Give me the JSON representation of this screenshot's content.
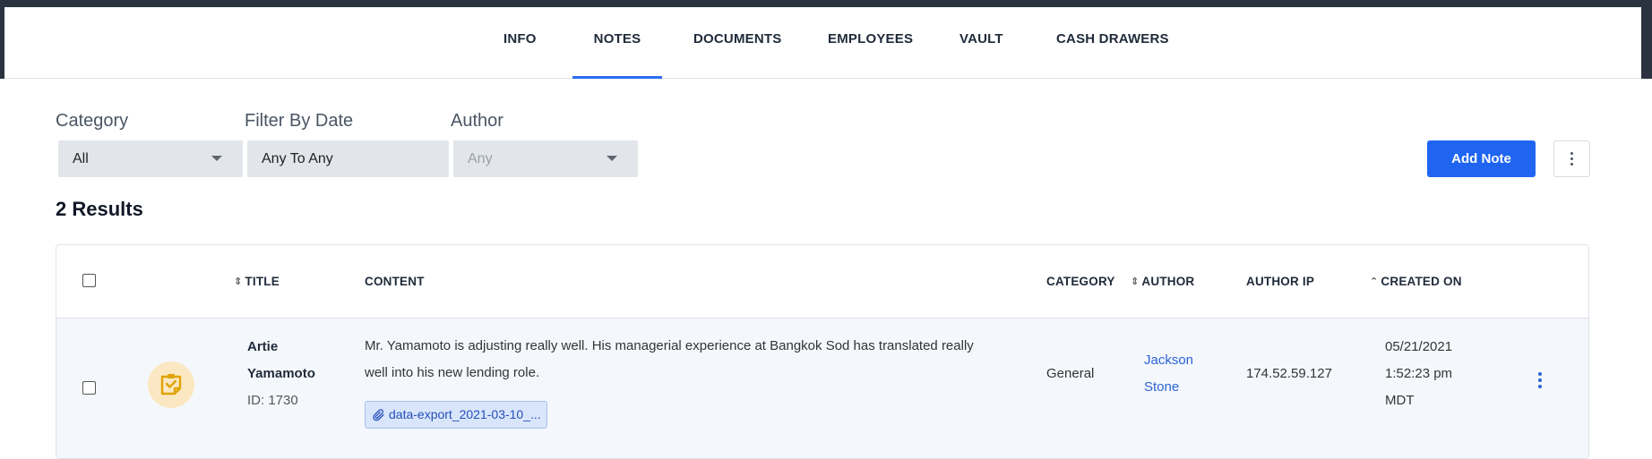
{
  "tabs": [
    {
      "label": "INFO",
      "active": false
    },
    {
      "label": "NOTES",
      "active": true
    },
    {
      "label": "DOCUMENTS",
      "active": false
    },
    {
      "label": "EMPLOYEES",
      "active": false
    },
    {
      "label": "VAULT",
      "active": false
    },
    {
      "label": "CASH DRAWERS",
      "active": false
    }
  ],
  "filters": {
    "category": {
      "label": "Category",
      "value": "All"
    },
    "date": {
      "label": "Filter By Date",
      "value": "Any To Any"
    },
    "author": {
      "label": "Author",
      "value": "Any",
      "disabled": true
    }
  },
  "actions": {
    "add_note_label": "Add Note"
  },
  "results_label": "2 Results",
  "table": {
    "columns": [
      "TITLE",
      "CONTENT",
      "CATEGORY",
      "AUTHOR",
      "AUTHOR IP",
      "CREATED ON"
    ],
    "rows": [
      {
        "title_line1": "Artie",
        "title_line2": "Yamamoto",
        "id": "ID: 1730",
        "content_line1": "Mr. Yamamoto is adjusting really well. His managerial experience at Bangkok Sod has translated really",
        "content_line2": "well into his new lending role.",
        "attachment": "data-export_2021-03-10_...",
        "category": "General",
        "author_line1": "Jackson",
        "author_line2": "Stone",
        "author_ip": "174.52.59.127",
        "created_date": "05/21/2021",
        "created_time": "1:52:23 pm",
        "created_tz": "MDT"
      }
    ]
  },
  "colors": {
    "accent": "#1f65f2",
    "link": "#2c62d6",
    "topbar": "#2b3340",
    "row_bg": "#f4f8fd",
    "note_icon_bg": "#fbe8c2"
  },
  "icons": {
    "note": "sticky-note-check-icon",
    "attachment": "paperclip-icon",
    "row_menu": "kebab-menu-icon"
  }
}
